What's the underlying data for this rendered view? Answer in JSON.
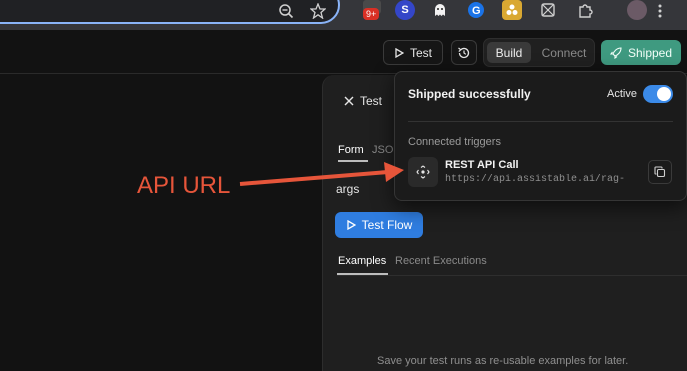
{
  "browser": {
    "badge": "9+",
    "extensions": [
      {
        "name": "zoom-icon"
      },
      {
        "name": "star-icon"
      },
      {
        "name": "s-extension-icon",
        "letter": "S",
        "color": "#3446c8"
      },
      {
        "name": "ghost-extension-icon"
      },
      {
        "name": "g-extension-icon"
      },
      {
        "name": "honeycomb-extension-icon"
      },
      {
        "name": "puzzle-icon"
      },
      {
        "name": "profile-avatar"
      }
    ]
  },
  "header": {
    "test_label": "Test",
    "segment": {
      "build": "Build",
      "connect": "Connect"
    },
    "shipped_label": "Shipped",
    "accent": "#3f9a80"
  },
  "test_panel": {
    "close_label": "Test",
    "tabs": {
      "form": "Form",
      "json": "JSO"
    },
    "args_label": "args",
    "test_flow_label": "Test Flow",
    "lower_tabs": {
      "examples": "Examples",
      "recent": "Recent Executions"
    },
    "save_hint": "Save your test runs as re-usable examples for later."
  },
  "popover": {
    "title": "Shipped successfully",
    "active_label": "Active",
    "toggle_on": true,
    "triggers_label": "Connected triggers",
    "trigger": {
      "name": "REST API Call",
      "url": "https://api.assistable.ai/rag-"
    }
  },
  "annotation": {
    "label": "API URL",
    "color": "#e6553a"
  }
}
